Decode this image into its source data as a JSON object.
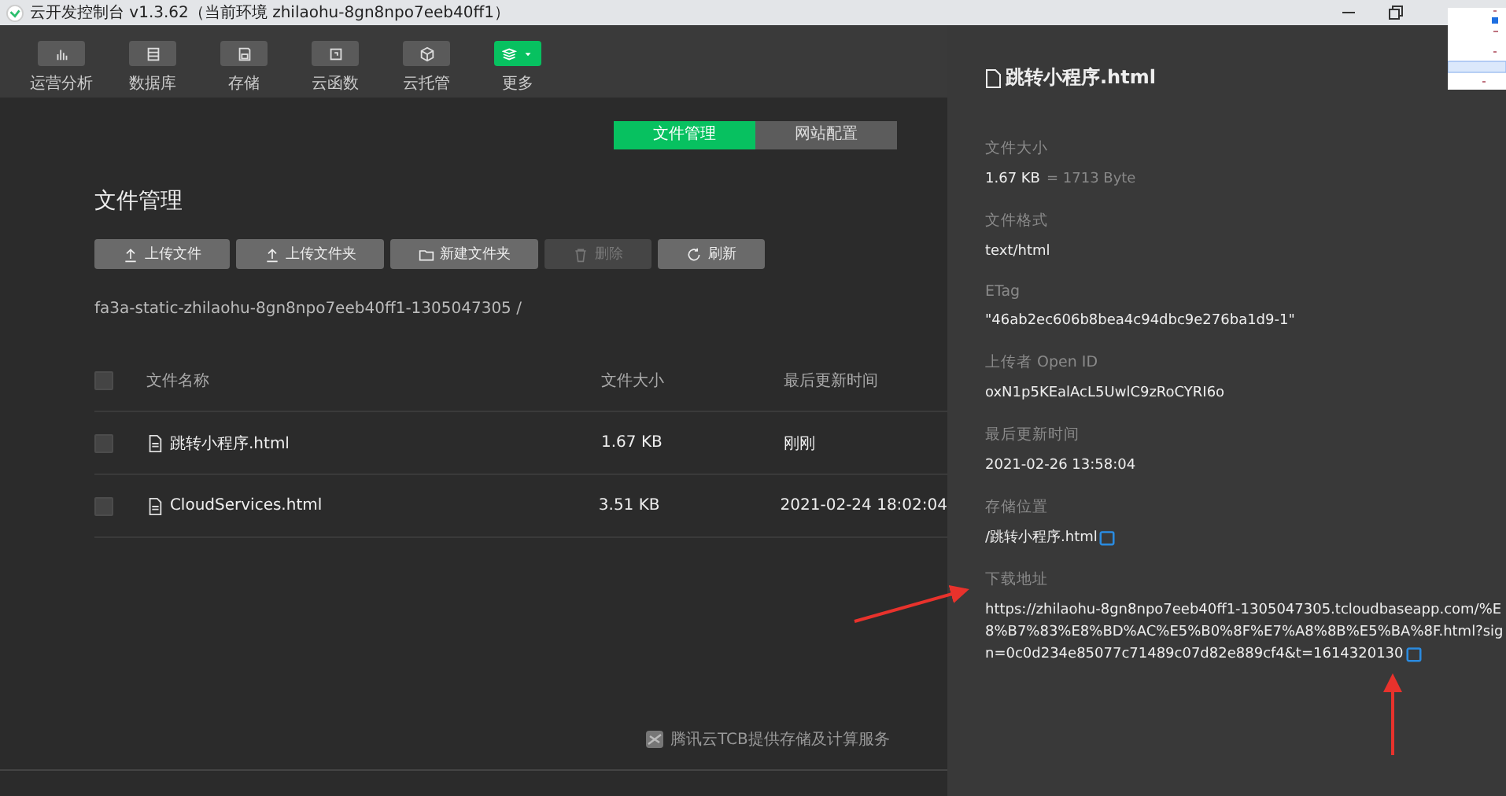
{
  "window": {
    "title": "云开发控制台 v1.3.62（当前环境 zhilaohu-8gn8npo7eeb40ff1）"
  },
  "toolbar": [
    {
      "kind": "analytics",
      "label": "运营分析",
      "selected": false
    },
    {
      "kind": "database",
      "label": "数据库",
      "selected": false
    },
    {
      "kind": "storage",
      "label": "存储",
      "selected": false
    },
    {
      "kind": "functions",
      "label": "云函数",
      "selected": false
    },
    {
      "kind": "hosting",
      "label": "云托管",
      "selected": false
    },
    {
      "kind": "more",
      "label": "更多",
      "selected": true
    }
  ],
  "tabs": [
    {
      "label": "文件管理",
      "selected": true
    },
    {
      "label": "网站配置",
      "selected": false
    }
  ],
  "heading": "文件管理",
  "buttons": [
    {
      "kind": "upload",
      "label": "上传文件",
      "disabled": false
    },
    {
      "kind": "upload",
      "label": "上传文件夹",
      "disabled": false
    },
    {
      "kind": "folder",
      "label": "新建文件夹",
      "disabled": false
    },
    {
      "kind": "delete",
      "label": "删除",
      "disabled": true
    },
    {
      "kind": "refresh",
      "label": "刷新",
      "disabled": false
    }
  ],
  "path": "fa3a-static-zhilaohu-8gn8npo7eeb40ff1-1305047305 /",
  "table": {
    "columns": [
      "文件名称",
      "文件大小",
      "最后更新时间"
    ],
    "header_checked": false,
    "rows": [
      {
        "name": "跳转小程序.html",
        "size": "1.67 KB",
        "updated": "刚刚",
        "checked": false
      },
      {
        "name": "CloudServices.html",
        "size": "3.51 KB",
        "updated": "2021-02-24 18:02:04",
        "checked": false
      }
    ]
  },
  "footer": "腾讯云TCB提供存储及计算服务",
  "detail": {
    "title": "跳转小程序.html",
    "fields": [
      {
        "label": "文件大小",
        "value": "1.67 KB",
        "note": "= 1713 Byte",
        "copyable": false
      },
      {
        "label": "文件格式",
        "value": "text/html",
        "copyable": false
      },
      {
        "label": "ETag",
        "value": "\"46ab2ec606b8bea4c94dbc9e276ba1d9-1\"",
        "copyable": false
      },
      {
        "label": "上传者 Open ID",
        "value": "oxN1p5KEalAcL5UwlC9zRoCYRI6o",
        "copyable": false
      },
      {
        "label": "最后更新时间",
        "value": "2021-02-26 13:58:04",
        "copyable": false
      },
      {
        "label": "存储位置",
        "value": "/跳转小程序.html",
        "copyable": true
      },
      {
        "label": "下载地址",
        "value": "https://zhilaohu-8gn8npo7eeb40ff1-1305047305.tcloudbaseapp.com/%E8%B7%83%E8%BD%AC%E5%B0%8F%E7%A8%8B%E5%BA%8F.html?sign=0c0d234e85077c71489c07d82e889cf4&t=1614320130",
        "copyable": true
      }
    ]
  }
}
